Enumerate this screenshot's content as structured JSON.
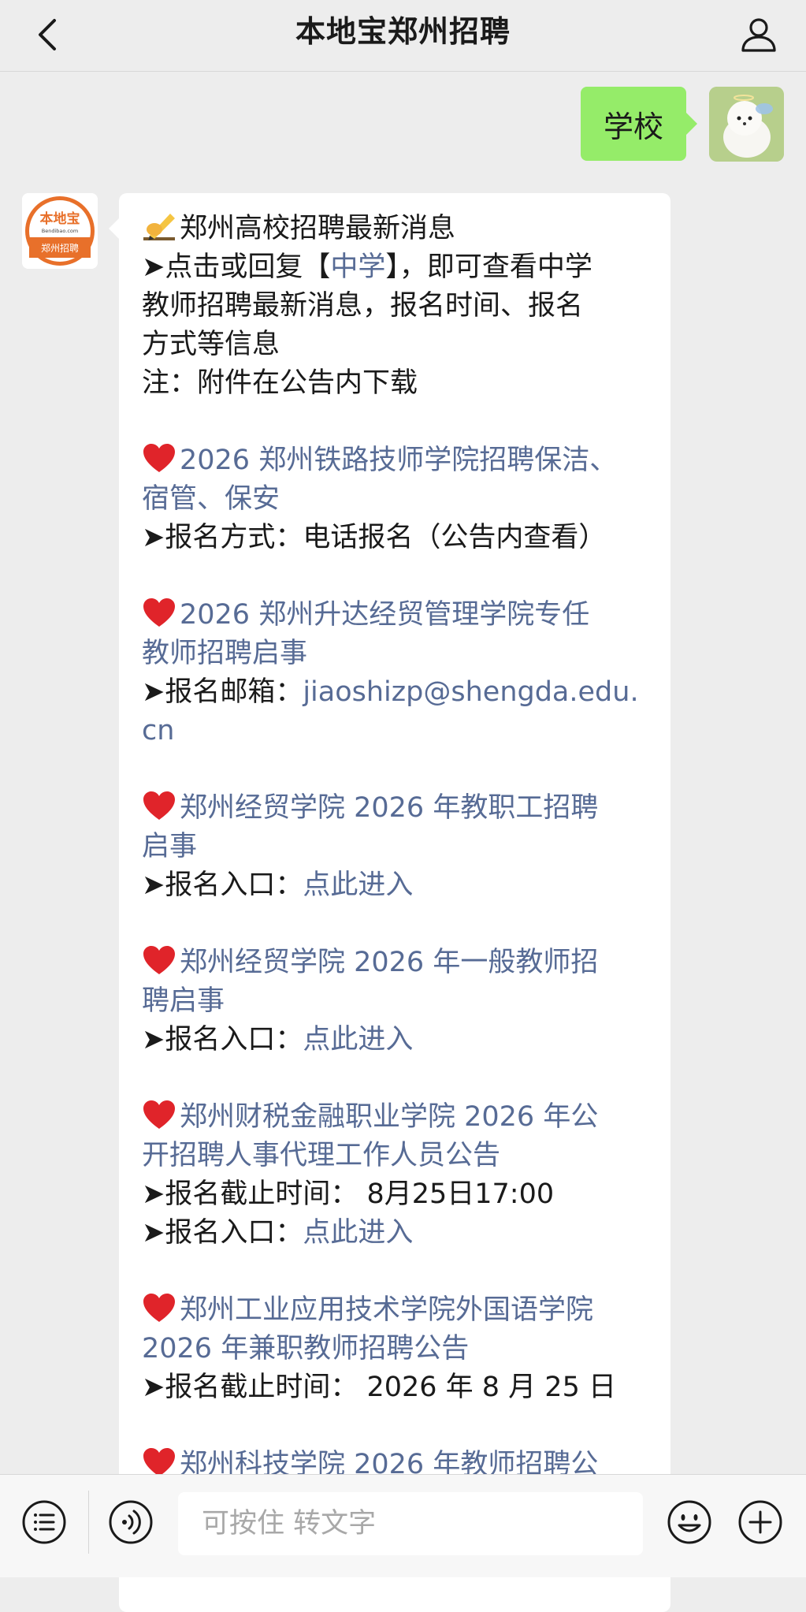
{
  "header": {
    "title": "本地宝郑州招聘"
  },
  "sent_message": {
    "text": "学校"
  },
  "bot_avatar": {
    "logo_top": "本地宝",
    "logo_url": "Bendibao.com",
    "logo_bottom": "郑州招聘"
  },
  "message": {
    "intro_title": "郑州高校招聘最新消息",
    "intro_pre": "➤点击或回复【",
    "intro_link": "中学",
    "intro_post": "】，即可查看中学",
    "intro_line2": "教师招聘最新消息，报名时间、报名",
    "intro_line3": "方式等信息",
    "intro_note": "注：附件在公告内下载",
    "items": [
      {
        "title_l1": "2026 郑州铁路技师学院招聘保洁、",
        "title_l2": "宿管、保安",
        "detail_l1": "➤报名方式：电话报名（公告内查看）"
      },
      {
        "title_l1": "2026 郑州升达经贸管理学院专任",
        "title_l2": "教师招聘启事",
        "detail_prefix": "➤报名邮箱：",
        "detail_value_l1": "jiaoshizp@shengda.edu.",
        "detail_value_l2": "cn"
      },
      {
        "title_l1": "郑州经贸学院 2026 年教职工招聘",
        "title_l2": "启事",
        "detail_prefix": "➤报名入口：",
        "detail_link": "点此进入"
      },
      {
        "title_l1": "郑州经贸学院 2026 年一般教师招",
        "title_l2": "聘启事",
        "detail_prefix": "➤报名入口：",
        "detail_link": "点此进入"
      },
      {
        "title_l1": "郑州财税金融职业学院 2026 年公",
        "title_l2": "开招聘人事代理工作人员公告",
        "detail_l1": "➤报名截止时间：  8月25日17:00",
        "detail_prefix": "➤报名入口：",
        "detail_link": "点此进入"
      },
      {
        "title_l1": "郑州工业应用技术学院外国语学院",
        "title_l2": "2026 年兼职教师招聘公告",
        "detail_l1": "➤报名截止时间：  2026 年 8 月 25 日"
      },
      {
        "title_l1": "郑州科技学院 2026 年教师招聘公"
      }
    ]
  },
  "input": {
    "placeholder": "可按住 转文字"
  },
  "colors": {
    "link": "#576b95",
    "sent_bubble": "#95ec69",
    "background": "#ededed",
    "heart": "#e0242a"
  },
  "icons": [
    "back-arrow-icon",
    "person-icon",
    "heart-icon",
    "writing-hand-icon",
    "menu-list-icon",
    "voice-icon",
    "emoji-icon",
    "plus-icon"
  ]
}
